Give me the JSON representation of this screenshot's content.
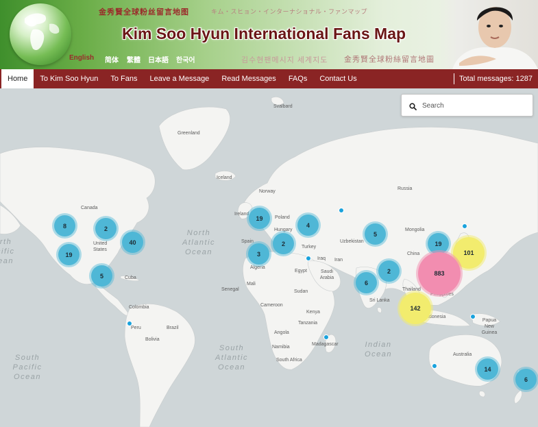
{
  "banner": {
    "chinese_top": "金秀賢全球粉丝留言地图",
    "japanese": "キム・スヒョン・インターナショナル・ファンマップ",
    "title": "Kim Soo Hyun International Fans Map",
    "korean": "김수현팬메시지 세계지도",
    "chinese_bottom": "金秀賢全球粉絲留言地圖",
    "languages": [
      "English",
      "简体",
      "繁體",
      "日本語",
      "한국어"
    ],
    "active_language": "English"
  },
  "nav": {
    "items": [
      "Home",
      "To Kim Soo Hyun",
      "To Fans",
      "Leave a Message",
      "Read Messages",
      "FAQs",
      "Contact Us"
    ],
    "active": "Home",
    "total_messages_label": "Total messages: 1287"
  },
  "search": {
    "placeholder": "Search",
    "value": ""
  },
  "map": {
    "country_labels": [
      "Svalbard",
      "Greenland",
      "Iceland",
      "Norway",
      "Canada",
      "United States",
      "Cuba",
      "Colombia",
      "Peru",
      "Brazil",
      "Bolivia",
      "Ireland",
      "Poland",
      "Hungary",
      "Spain",
      "Algeria",
      "Mali",
      "Senegal",
      "Cameroon",
      "Egypt",
      "Sudan",
      "Turkey",
      "Iraq",
      "Iran",
      "Saudi Arabia",
      "Kenya",
      "Tanzania",
      "Angola",
      "Namibia",
      "South Africa",
      "Madagascar",
      "Russia",
      "Uzbekistan",
      "Mongolia",
      "China",
      "Sri Lanka",
      "Thailand",
      "Philippines",
      "Indonesia",
      "Papua New Guinea",
      "Australia"
    ],
    "oceans": [
      "North Atlantic Ocean",
      "South Atlantic Ocean",
      "South Pacific Ocean",
      "Indian Ocean",
      "North Pacific Ocean"
    ],
    "clusters": [
      {
        "id": "na-west",
        "count": "8",
        "style": "blue"
      },
      {
        "id": "na-central",
        "count": "2",
        "style": "blue"
      },
      {
        "id": "na-east",
        "count": "40",
        "style": "blue"
      },
      {
        "id": "na-south",
        "count": "19",
        "style": "blue"
      },
      {
        "id": "mexico",
        "count": "5",
        "style": "blue"
      },
      {
        "id": "uk",
        "count": "19",
        "style": "blue"
      },
      {
        "id": "east-europe",
        "count": "4",
        "style": "blue"
      },
      {
        "id": "balkans",
        "count": "2",
        "style": "blue"
      },
      {
        "id": "north-africa",
        "count": "3",
        "style": "blue"
      },
      {
        "id": "central-asia",
        "count": "5",
        "style": "blue"
      },
      {
        "id": "south-asia",
        "count": "2",
        "style": "blue"
      },
      {
        "id": "india-south",
        "count": "6",
        "style": "blue"
      },
      {
        "id": "north-china",
        "count": "19",
        "style": "blue"
      },
      {
        "id": "japan",
        "count": "101",
        "style": "yellow"
      },
      {
        "id": "east-asia",
        "count": "883",
        "style": "pink"
      },
      {
        "id": "southeast-asia",
        "count": "142",
        "style": "yellow"
      },
      {
        "id": "australia",
        "count": "14",
        "style": "blue"
      },
      {
        "id": "new-zealand",
        "count": "6",
        "style": "blue"
      }
    ],
    "single_markers": [
      "russia-west",
      "north-japan",
      "middle-east",
      "peru",
      "madagascar",
      "papua",
      "west-australia"
    ]
  }
}
